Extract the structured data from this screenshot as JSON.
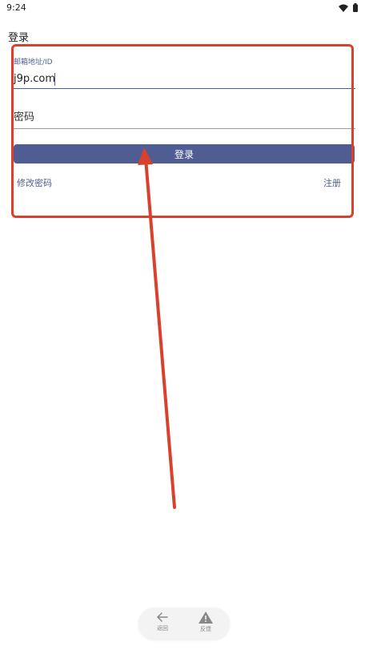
{
  "status_bar": {
    "time": "9:24"
  },
  "header": {
    "title": "登录"
  },
  "form": {
    "email_label": "邮箱地址/ID",
    "email_value": "j9p.com",
    "password_placeholder": "密码",
    "login_button": "登录",
    "change_password_link": "修改密码",
    "register_link": "注册"
  },
  "bottom_nav": {
    "back_label": "返回",
    "feedback_label": "反馈"
  },
  "colors": {
    "accent": "#4f5d93",
    "annotation": "#d9412c"
  }
}
